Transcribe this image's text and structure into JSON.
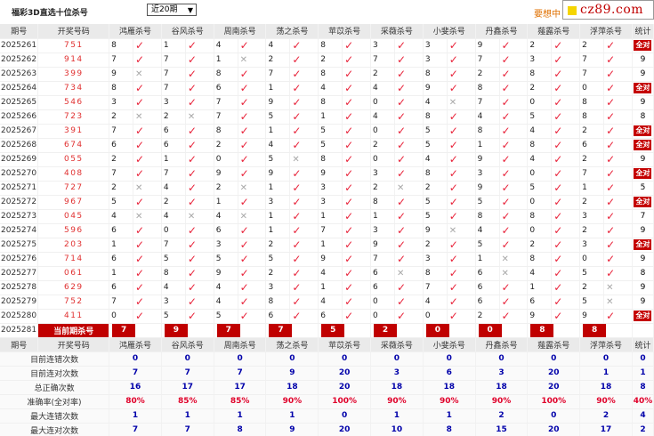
{
  "header": {
    "title": "福彩3D直选十位杀号",
    "period_select": "近20期",
    "promo": "要想中",
    "logo_text": "cz89.com"
  },
  "columns": {
    "period": "期号",
    "draw": "开奖号码",
    "experts": [
      "鸿雁杀号",
      "谷风杀号",
      "周南杀号",
      "荡之杀号",
      "苹苡杀号",
      "采薇杀号",
      "小斐杀号",
      "丹鑫杀号",
      "薤露杀号",
      "浮萍杀号"
    ],
    "stat": "统计"
  },
  "rows": [
    {
      "period": "2025261",
      "draw": "751",
      "nums": [
        "8",
        "1",
        "4",
        "4",
        "8",
        "3",
        "3",
        "9",
        "2",
        "2"
      ],
      "hits": [
        1,
        1,
        1,
        1,
        1,
        1,
        1,
        1,
        1,
        1
      ],
      "stat": "全对"
    },
    {
      "period": "2025262",
      "draw": "914",
      "nums": [
        "7",
        "7",
        "1",
        "2",
        "2",
        "7",
        "3",
        "7",
        "3",
        "7"
      ],
      "hits": [
        1,
        1,
        0,
        1,
        1,
        1,
        1,
        1,
        1,
        1
      ],
      "stat": "9"
    },
    {
      "period": "2025263",
      "draw": "399",
      "nums": [
        "9",
        "7",
        "8",
        "7",
        "8",
        "2",
        "8",
        "2",
        "8",
        "7"
      ],
      "hits": [
        0,
        1,
        1,
        1,
        1,
        1,
        1,
        1,
        1,
        1
      ],
      "stat": "9"
    },
    {
      "period": "2025264",
      "draw": "734",
      "nums": [
        "8",
        "7",
        "6",
        "1",
        "4",
        "4",
        "9",
        "8",
        "2",
        "0"
      ],
      "hits": [
        1,
        1,
        1,
        1,
        1,
        1,
        1,
        1,
        1,
        1
      ],
      "stat": "全对"
    },
    {
      "period": "2025265",
      "draw": "546",
      "nums": [
        "3",
        "3",
        "7",
        "9",
        "8",
        "0",
        "4",
        "7",
        "0",
        "8"
      ],
      "hits": [
        1,
        1,
        1,
        1,
        1,
        1,
        0,
        1,
        1,
        1
      ],
      "stat": "9"
    },
    {
      "period": "2025266",
      "draw": "723",
      "nums": [
        "2",
        "2",
        "7",
        "5",
        "1",
        "4",
        "8",
        "4",
        "5",
        "8"
      ],
      "hits": [
        0,
        0,
        1,
        1,
        1,
        1,
        1,
        1,
        1,
        1
      ],
      "stat": "8"
    },
    {
      "period": "2025267",
      "draw": "391",
      "nums": [
        "7",
        "6",
        "8",
        "1",
        "5",
        "0",
        "5",
        "8",
        "4",
        "2"
      ],
      "hits": [
        1,
        1,
        1,
        1,
        1,
        1,
        1,
        1,
        1,
        1
      ],
      "stat": "全对"
    },
    {
      "period": "2025268",
      "draw": "674",
      "nums": [
        "6",
        "6",
        "2",
        "4",
        "5",
        "2",
        "5",
        "1",
        "8",
        "6"
      ],
      "hits": [
        1,
        1,
        1,
        1,
        1,
        1,
        1,
        1,
        1,
        1
      ],
      "stat": "全对"
    },
    {
      "period": "2025269",
      "draw": "055",
      "nums": [
        "2",
        "1",
        "0",
        "5",
        "8",
        "0",
        "4",
        "9",
        "4",
        "2"
      ],
      "hits": [
        1,
        1,
        1,
        0,
        1,
        1,
        1,
        1,
        1,
        1
      ],
      "stat": "9"
    },
    {
      "period": "2025270",
      "draw": "408",
      "nums": [
        "7",
        "7",
        "9",
        "9",
        "9",
        "3",
        "8",
        "3",
        "0",
        "7"
      ],
      "hits": [
        1,
        1,
        1,
        1,
        1,
        1,
        1,
        1,
        1,
        1
      ],
      "stat": "全对"
    },
    {
      "period": "2025271",
      "draw": "727",
      "nums": [
        "2",
        "4",
        "2",
        "1",
        "3",
        "2",
        "2",
        "9",
        "5",
        "1"
      ],
      "hits": [
        0,
        1,
        0,
        1,
        1,
        0,
        1,
        1,
        1,
        1
      ],
      "stat": "5"
    },
    {
      "period": "2025272",
      "draw": "967",
      "nums": [
        "5",
        "2",
        "1",
        "3",
        "3",
        "8",
        "5",
        "5",
        "0",
        "2"
      ],
      "hits": [
        1,
        1,
        1,
        1,
        1,
        1,
        1,
        1,
        1,
        1
      ],
      "stat": "全对"
    },
    {
      "period": "2025273",
      "draw": "045",
      "nums": [
        "4",
        "4",
        "4",
        "1",
        "1",
        "1",
        "5",
        "8",
        "8",
        "3"
      ],
      "hits": [
        0,
        0,
        0,
        1,
        1,
        1,
        1,
        1,
        1,
        1
      ],
      "stat": "7"
    },
    {
      "period": "2025274",
      "draw": "596",
      "nums": [
        "6",
        "0",
        "6",
        "1",
        "7",
        "3",
        "9",
        "4",
        "0",
        "2"
      ],
      "hits": [
        1,
        1,
        1,
        1,
        1,
        1,
        0,
        1,
        1,
        1
      ],
      "stat": "9"
    },
    {
      "period": "2025275",
      "draw": "203",
      "nums": [
        "1",
        "7",
        "3",
        "2",
        "1",
        "9",
        "2",
        "5",
        "2",
        "3"
      ],
      "hits": [
        1,
        1,
        1,
        1,
        1,
        1,
        1,
        1,
        1,
        1
      ],
      "stat": "全对"
    },
    {
      "period": "2025276",
      "draw": "714",
      "nums": [
        "6",
        "5",
        "5",
        "5",
        "9",
        "7",
        "3",
        "1",
        "8",
        "0"
      ],
      "hits": [
        1,
        1,
        1,
        1,
        1,
        1,
        1,
        0,
        1,
        1
      ],
      "stat": "9"
    },
    {
      "period": "2025277",
      "draw": "061",
      "nums": [
        "1",
        "8",
        "9",
        "2",
        "4",
        "6",
        "8",
        "6",
        "4",
        "5"
      ],
      "hits": [
        1,
        1,
        1,
        1,
        1,
        0,
        1,
        0,
        1,
        1
      ],
      "stat": "8"
    },
    {
      "period": "2025278",
      "draw": "629",
      "nums": [
        "6",
        "4",
        "4",
        "3",
        "1",
        "6",
        "7",
        "6",
        "1",
        "2"
      ],
      "hits": [
        1,
        1,
        1,
        1,
        1,
        1,
        1,
        1,
        1,
        0
      ],
      "stat": "9"
    },
    {
      "period": "2025279",
      "draw": "752",
      "nums": [
        "7",
        "3",
        "4",
        "8",
        "4",
        "0",
        "4",
        "6",
        "6",
        "5"
      ],
      "hits": [
        1,
        1,
        1,
        1,
        1,
        1,
        1,
        1,
        1,
        0
      ],
      "stat": "9"
    },
    {
      "period": "2025280",
      "draw": "411",
      "nums": [
        "0",
        "5",
        "5",
        "6",
        "6",
        "0",
        "0",
        "2",
        "9",
        "9"
      ],
      "hits": [
        1,
        1,
        1,
        1,
        1,
        1,
        1,
        1,
        1,
        1
      ],
      "stat": "全对"
    }
  ],
  "current": {
    "period": "2025281",
    "label": "当前期杀号",
    "nums": [
      "7",
      "9",
      "7",
      "7",
      "5",
      "2",
      "0",
      "0",
      "8",
      "8"
    ]
  },
  "summary": [
    {
      "label": "目前连错次数",
      "values": [
        "0",
        "0",
        "0",
        "0",
        "0",
        "0",
        "0",
        "0",
        "0",
        "0",
        "0"
      ]
    },
    {
      "label": "目前连对次数",
      "values": [
        "7",
        "7",
        "7",
        "9",
        "20",
        "3",
        "6",
        "3",
        "20",
        "1",
        "1"
      ]
    },
    {
      "label": "总正确次数",
      "values": [
        "16",
        "17",
        "17",
        "18",
        "20",
        "18",
        "18",
        "18",
        "20",
        "18",
        "8"
      ]
    },
    {
      "label": "准确率(全对率)",
      "values": [
        "80%",
        "85%",
        "85%",
        "90%",
        "100%",
        "90%",
        "90%",
        "90%",
        "100%",
        "90%",
        "40%"
      ]
    },
    {
      "label": "最大连错次数",
      "values": [
        "1",
        "1",
        "1",
        "1",
        "0",
        "1",
        "1",
        "2",
        "0",
        "2",
        "4"
      ]
    },
    {
      "label": "最大连对次数",
      "values": [
        "7",
        "7",
        "8",
        "9",
        "20",
        "10",
        "8",
        "15",
        "20",
        "17",
        "2"
      ]
    }
  ],
  "icons": {
    "hit": "check-icon",
    "miss": "cross-icon"
  },
  "colors": {
    "accent": "#c00000",
    "tick": "#e8233a",
    "summary_value": "#0000aa"
  }
}
